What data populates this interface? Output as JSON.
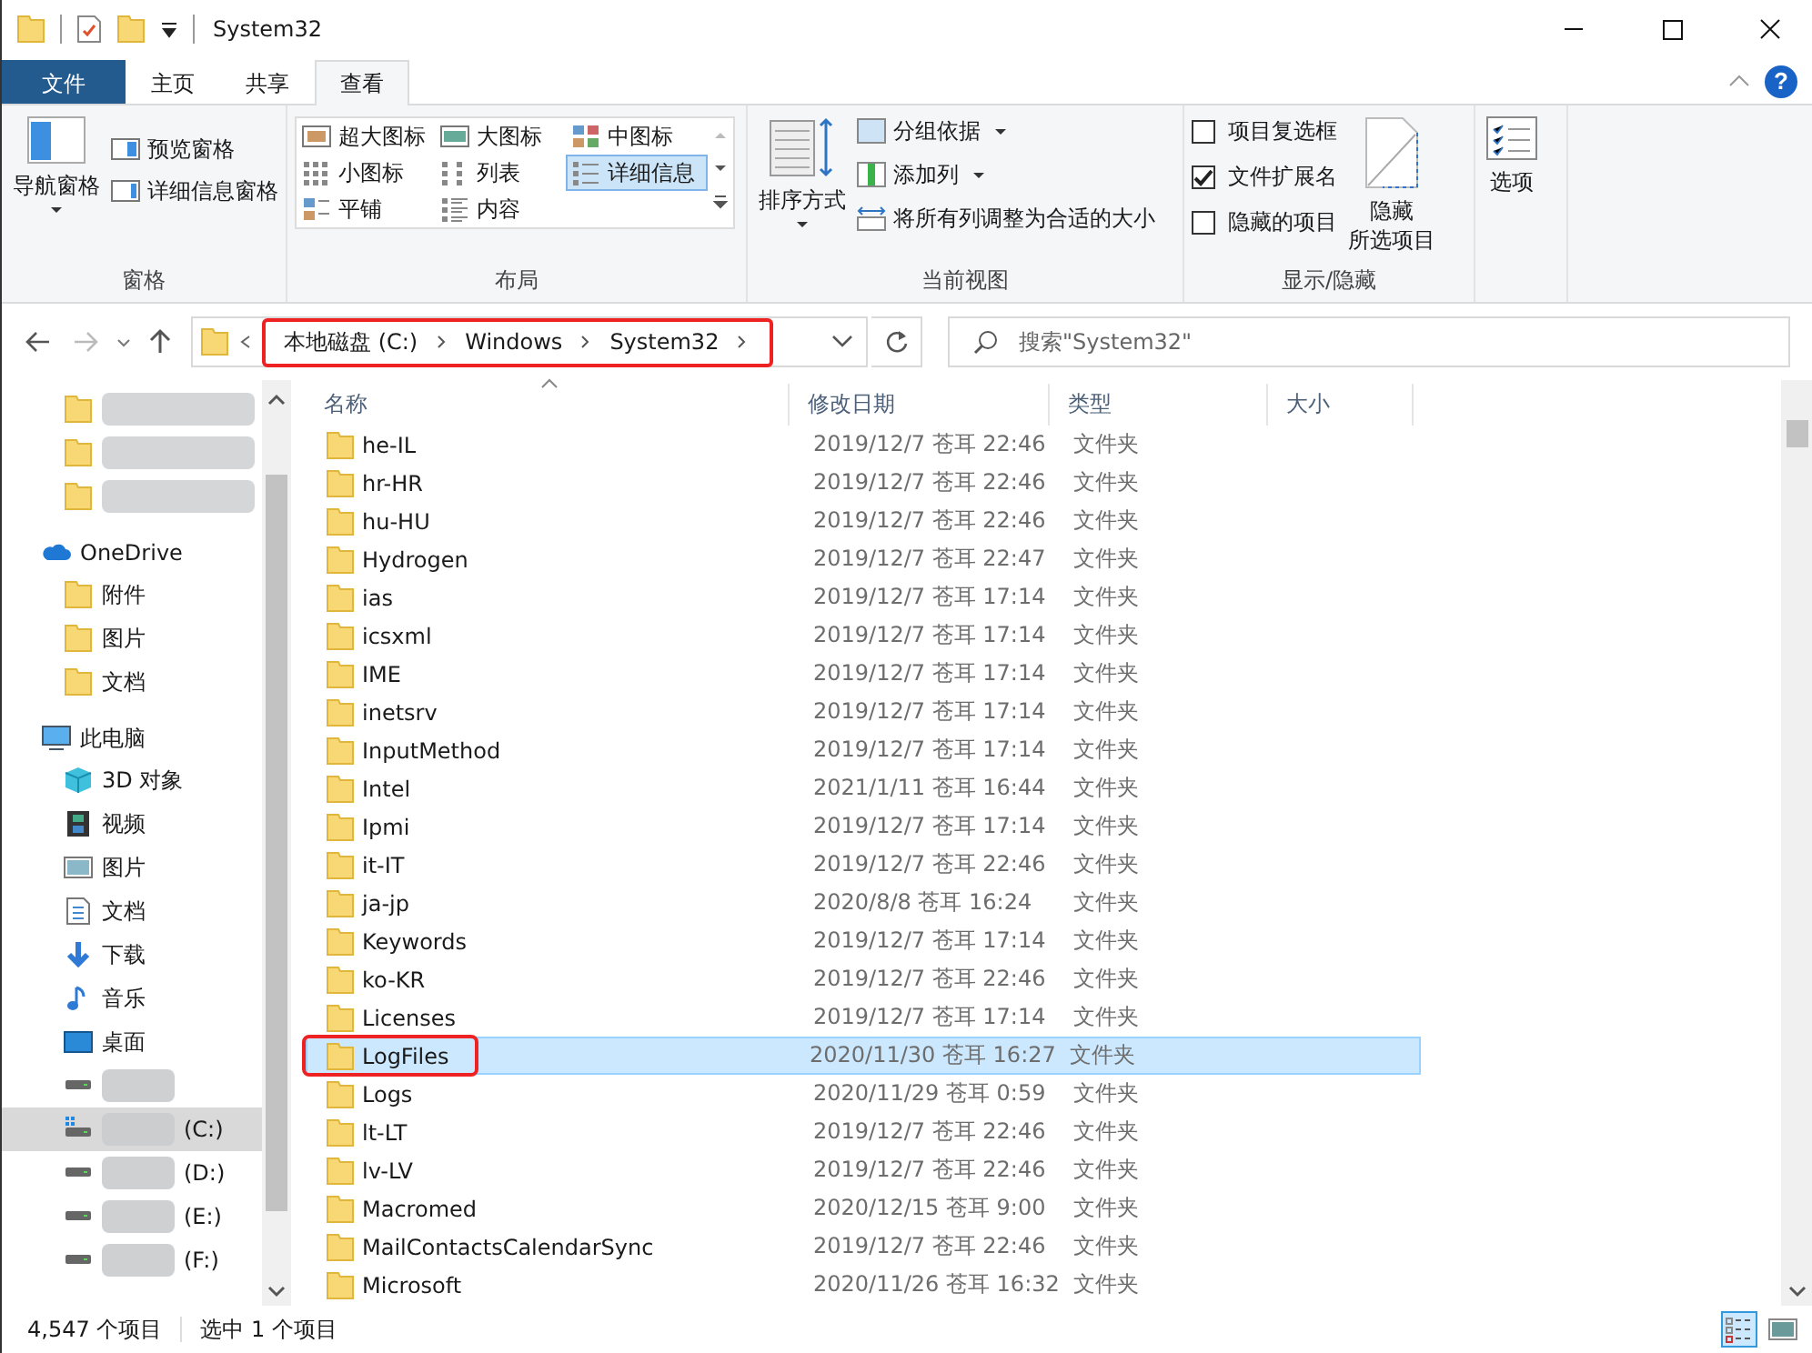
{
  "window": {
    "title": "System32"
  },
  "ribbon_tabs": [
    {
      "label": "文件",
      "kind": "file",
      "selected": false
    },
    {
      "label": "主页",
      "kind": "tab",
      "selected": false
    },
    {
      "label": "共享",
      "kind": "tab",
      "selected": false
    },
    {
      "label": "查看",
      "kind": "tab",
      "selected": true
    }
  ],
  "help_button": {
    "glyph": "?"
  },
  "ribbon": {
    "panes": {
      "big": "导航窗格",
      "small": [
        "预览窗格",
        "详细信息窗格"
      ],
      "label": "窗格"
    },
    "layout": {
      "options": [
        {
          "label": "超大图标",
          "selected": false
        },
        {
          "label": "大图标",
          "selected": false
        },
        {
          "label": "中图标",
          "selected": false
        },
        {
          "label": "小图标",
          "selected": false
        },
        {
          "label": "列表",
          "selected": false
        },
        {
          "label": "详细信息",
          "selected": true
        },
        {
          "label": "平铺",
          "selected": false
        },
        {
          "label": "内容",
          "selected": false
        }
      ],
      "label": "布局"
    },
    "current_view": {
      "big": "排序方式",
      "small": [
        "分组依据",
        "添加列",
        "将所有列调整为合适的大小"
      ],
      "label": "当前视图"
    },
    "show_hide": {
      "checkboxes": [
        {
          "label": "项目复选框",
          "checked": false
        },
        {
          "label": "文件扩展名",
          "checked": true
        },
        {
          "label": "隐藏的项目",
          "checked": false
        }
      ],
      "big": [
        "隐藏",
        "所选项目"
      ],
      "label": "显示/隐藏"
    },
    "options": {
      "big": "选项"
    }
  },
  "address_bar": {
    "crumbs": [
      "本地磁盘 (C:)",
      "Windows",
      "System32"
    ],
    "annotated": true
  },
  "search": {
    "placeholder": "搜索\"System32\""
  },
  "sidebar": {
    "items": [
      {
        "kind": "blurred-folder",
        "selected": false
      },
      {
        "kind": "blurred-folder",
        "selected": false
      },
      {
        "kind": "blurred-folder",
        "selected": false
      },
      {
        "kind": "cloud",
        "label": "OneDrive",
        "selected": false,
        "children": [
          {
            "kind": "folder",
            "label": "附件",
            "selected": false
          },
          {
            "kind": "folder",
            "label": "图片",
            "selected": false
          },
          {
            "kind": "folder",
            "label": "文档",
            "selected": false
          }
        ]
      },
      {
        "kind": "pc",
        "label": "此电脑",
        "selected": false,
        "children": [
          {
            "kind": "cube",
            "label": "3D 对象",
            "selected": false
          },
          {
            "kind": "video",
            "label": "视频",
            "selected": false
          },
          {
            "kind": "picture",
            "label": "图片",
            "selected": false
          },
          {
            "kind": "document",
            "label": "文档",
            "selected": false
          },
          {
            "kind": "download",
            "label": "下载",
            "selected": false
          },
          {
            "kind": "music",
            "label": "音乐",
            "selected": false
          },
          {
            "kind": "desktop",
            "label": "桌面",
            "selected": false
          },
          {
            "kind": "drive",
            "selected": false
          },
          {
            "kind": "system-drive",
            "label": "(C:)",
            "selected": true
          },
          {
            "kind": "drive",
            "label": "(D:)",
            "selected": false
          },
          {
            "kind": "drive",
            "label": "(E:)",
            "selected": false
          },
          {
            "kind": "drive",
            "label": "(F:)",
            "selected": false
          }
        ]
      }
    ]
  },
  "table": {
    "columns": [
      "名称",
      "修改日期",
      "类型",
      "大小"
    ],
    "rows": [
      {
        "name": "he-IL",
        "date": "2019/12/7 苍耳 22:46",
        "type": "文件夹",
        "selected": false,
        "annotated": false
      },
      {
        "name": "hr-HR",
        "date": "2019/12/7 苍耳 22:46",
        "type": "文件夹",
        "selected": false,
        "annotated": false
      },
      {
        "name": "hu-HU",
        "date": "2019/12/7 苍耳 22:46",
        "type": "文件夹",
        "selected": false,
        "annotated": false
      },
      {
        "name": "Hydrogen",
        "date": "2019/12/7 苍耳 22:47",
        "type": "文件夹",
        "selected": false,
        "annotated": false
      },
      {
        "name": "ias",
        "date": "2019/12/7 苍耳 17:14",
        "type": "文件夹",
        "selected": false,
        "annotated": false
      },
      {
        "name": "icsxml",
        "date": "2019/12/7 苍耳 17:14",
        "type": "文件夹",
        "selected": false,
        "annotated": false
      },
      {
        "name": "IME",
        "date": "2019/12/7 苍耳 17:14",
        "type": "文件夹",
        "selected": false,
        "annotated": false
      },
      {
        "name": "inetsrv",
        "date": "2019/12/7 苍耳 17:14",
        "type": "文件夹",
        "selected": false,
        "annotated": false
      },
      {
        "name": "InputMethod",
        "date": "2019/12/7 苍耳 17:14",
        "type": "文件夹",
        "selected": false,
        "annotated": false
      },
      {
        "name": "Intel",
        "date": "2021/1/11 苍耳 16:44",
        "type": "文件夹",
        "selected": false,
        "annotated": false
      },
      {
        "name": "Ipmi",
        "date": "2019/12/7 苍耳 17:14",
        "type": "文件夹",
        "selected": false,
        "annotated": false
      },
      {
        "name": "it-IT",
        "date": "2019/12/7 苍耳 22:46",
        "type": "文件夹",
        "selected": false,
        "annotated": false
      },
      {
        "name": "ja-jp",
        "date": "2020/8/8 苍耳 16:24",
        "type": "文件夹",
        "selected": false,
        "annotated": false
      },
      {
        "name": "Keywords",
        "date": "2019/12/7 苍耳 17:14",
        "type": "文件夹",
        "selected": false,
        "annotated": false
      },
      {
        "name": "ko-KR",
        "date": "2019/12/7 苍耳 22:46",
        "type": "文件夹",
        "selected": false,
        "annotated": false
      },
      {
        "name": "Licenses",
        "date": "2019/12/7 苍耳 17:14",
        "type": "文件夹",
        "selected": false,
        "annotated": false
      },
      {
        "name": "LogFiles",
        "date": "2020/11/30 苍耳 16:27",
        "type": "文件夹",
        "selected": true,
        "annotated": true
      },
      {
        "name": "Logs",
        "date": "2020/11/29 苍耳 0:59",
        "type": "文件夹",
        "selected": false,
        "annotated": false
      },
      {
        "name": "lt-LT",
        "date": "2019/12/7 苍耳 22:46",
        "type": "文件夹",
        "selected": false,
        "annotated": false
      },
      {
        "name": "lv-LV",
        "date": "2019/12/7 苍耳 22:46",
        "type": "文件夹",
        "selected": false,
        "annotated": false
      },
      {
        "name": "Macromed",
        "date": "2020/12/15 苍耳 9:00",
        "type": "文件夹",
        "selected": false,
        "annotated": false
      },
      {
        "name": "MailContactsCalendarSync",
        "date": "2019/12/7 苍耳 22:46",
        "type": "文件夹",
        "selected": false,
        "annotated": false
      },
      {
        "name": "Microsoft",
        "date": "2020/11/26 苍耳 16:32",
        "type": "文件夹",
        "selected": false,
        "annotated": false
      }
    ]
  },
  "status_bar": {
    "count": "4,547 个项目",
    "selection": "选中 1 个项目"
  },
  "view_toggles": [
    {
      "kind": "details",
      "selected": true
    },
    {
      "kind": "thumbnails",
      "selected": false
    }
  ]
}
